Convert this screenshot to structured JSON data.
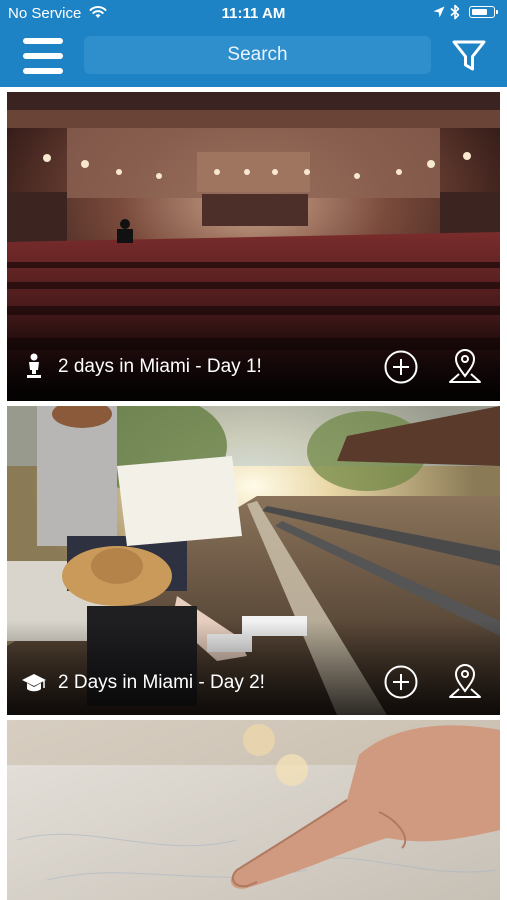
{
  "status_bar": {
    "carrier": "No Service",
    "time": "11:11 AM",
    "battery_level": 0.75,
    "icons": [
      "wifi-icon",
      "location-arrow-icon",
      "bluetooth-icon",
      "battery-icon"
    ]
  },
  "header": {
    "menu_icon": "hamburger-menu-icon",
    "search_placeholder": "Search",
    "filter_icon": "filter-funnel-icon"
  },
  "cards": [
    {
      "title": "2 days in Miami - Day 1!",
      "type_icon": "person-statue-icon",
      "actions": [
        "add-circle-icon",
        "map-pin-icon"
      ],
      "image": "theater-auditorium"
    },
    {
      "title": "2 Days in Miami - Day 2!",
      "type_icon": "graduation-cap-icon",
      "actions": [
        "add-circle-icon",
        "map-pin-icon"
      ],
      "image": "railway-traveler-map"
    },
    {
      "title": "",
      "image": "finger-on-map"
    }
  ],
  "colors": {
    "header_blue": "#1e83c4",
    "search_bg": "#2f8fcd",
    "text_white": "#ffffff"
  }
}
